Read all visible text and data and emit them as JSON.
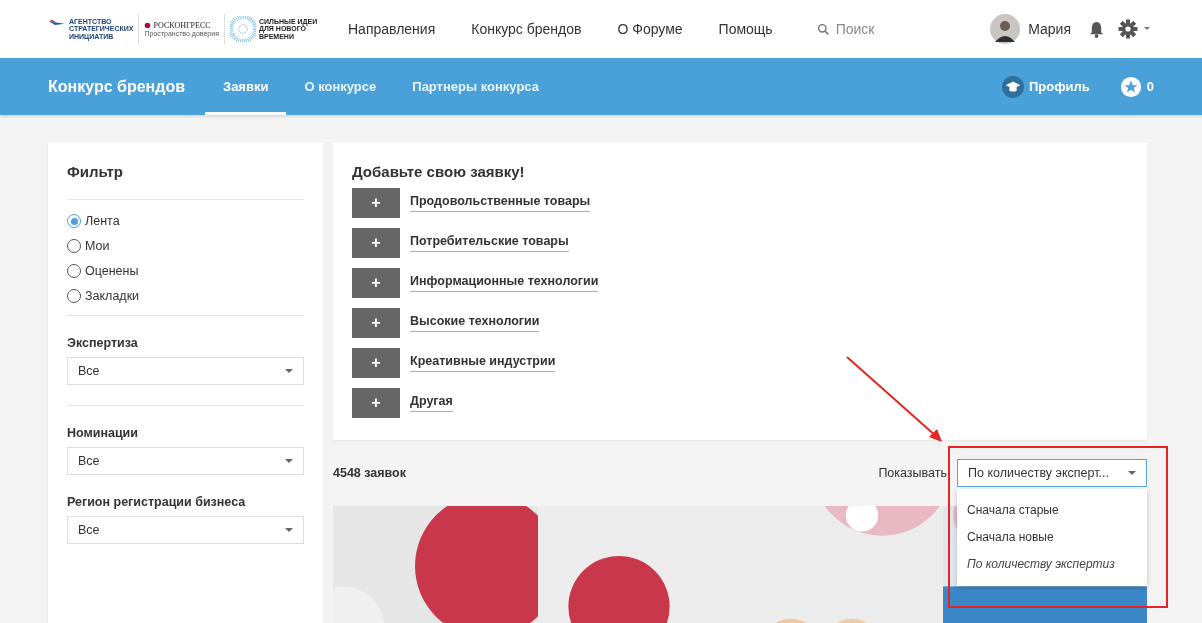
{
  "logos": {
    "asi": [
      "АГЕНТСТВО",
      "СТРАТЕГИЧЕСКИХ",
      "ИНИЦИАТИВ"
    ],
    "roscongress": "РОСКОНГРЕСС",
    "roscongress_sub": "Пространство доверия",
    "forum": [
      "СИЛЬНЫЕ ИДЕИ",
      "ДЛЯ НОВОГО",
      "ВРЕМЕНИ"
    ]
  },
  "top_nav": [
    "Направления",
    "Конкурс брендов",
    "О Форуме",
    "Помощь"
  ],
  "search": {
    "placeholder": "Поиск"
  },
  "user": {
    "name": "Мария"
  },
  "sub_nav": {
    "title": "Конкурс брендов",
    "tabs": [
      {
        "label": "Заявки",
        "selected": true
      },
      {
        "label": "О конкурсе",
        "selected": false
      },
      {
        "label": "Партнеры конкурса",
        "selected": false
      }
    ],
    "profile": "Профиль",
    "stars_count": "0"
  },
  "filter": {
    "title": "Фильтр",
    "options": [
      {
        "label": "Лента",
        "selected": true
      },
      {
        "label": "Мои",
        "selected": false
      },
      {
        "label": "Оценены",
        "selected": false
      },
      {
        "label": "Закладки",
        "selected": false
      }
    ],
    "selects": [
      {
        "label": "Экспертиза",
        "value": "Все"
      },
      {
        "label": "Номинации",
        "value": "Все"
      },
      {
        "label": "Регион регистрации бизнеса",
        "value": "Все"
      }
    ]
  },
  "add_card": {
    "title": "Добавьте свою заявку!",
    "button": "+",
    "categories": [
      "Продовольственные товары",
      "Потребительские товары",
      "Информационные технологии",
      "Высокие технологии",
      "Креативные индустрии",
      "Другая"
    ]
  },
  "count": "4548 заявок",
  "sort": {
    "label": "Показывать",
    "value": "По количеству эксперт...",
    "options": [
      {
        "label": "Сначала старые",
        "selected": false
      },
      {
        "label": "Сначала новые",
        "selected": false
      },
      {
        "label": "По количеству экспертиз",
        "selected": true
      }
    ]
  }
}
